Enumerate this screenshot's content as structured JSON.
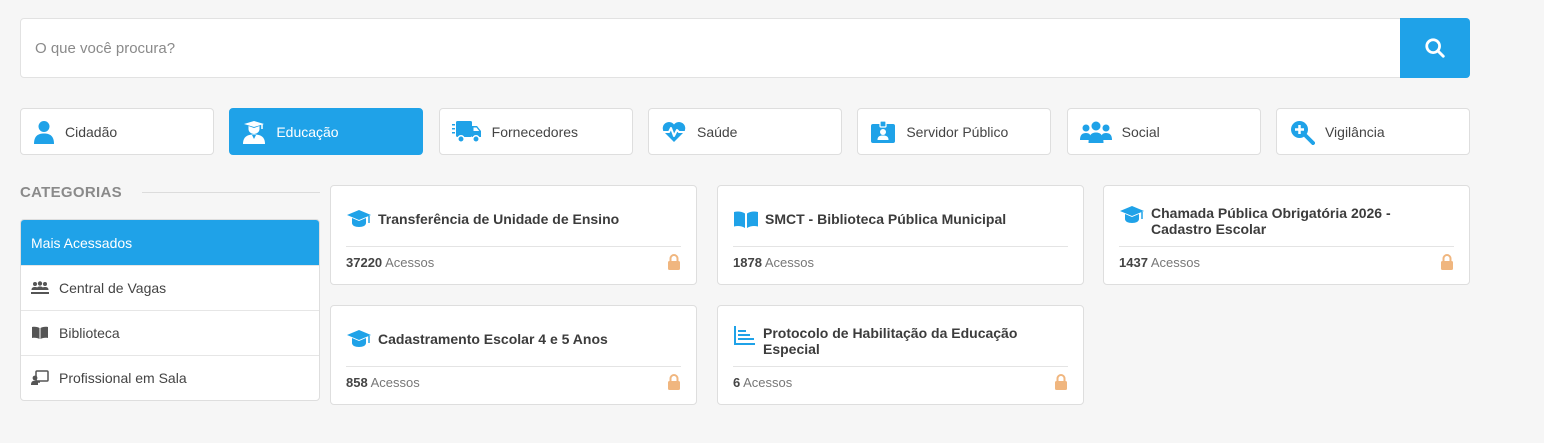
{
  "search": {
    "placeholder": "O que você procura?"
  },
  "colors": {
    "accent": "#1fa2e8",
    "lock": "#f0b67f"
  },
  "tabs": [
    {
      "label": "Cidadão",
      "icon": "user-icon",
      "active": false
    },
    {
      "label": "Educação",
      "icon": "teacher-icon",
      "active": true
    },
    {
      "label": "Fornecedores",
      "icon": "truck-icon",
      "active": false
    },
    {
      "label": "Saúde",
      "icon": "heartbeat-icon",
      "active": false
    },
    {
      "label": "Servidor Público",
      "icon": "id-badge-icon",
      "active": false
    },
    {
      "label": "Social",
      "icon": "users-icon",
      "active": false
    },
    {
      "label": "Vigilância",
      "icon": "search-plus-icon",
      "active": false
    }
  ],
  "categories": {
    "title": "CATEGORIAS",
    "items": [
      {
        "label": "Mais Acessados",
        "active": true,
        "icon": ""
      },
      {
        "label": "Central de Vagas",
        "active": false,
        "icon": "people-icon"
      },
      {
        "label": "Biblioteca",
        "active": false,
        "icon": "book-icon"
      },
      {
        "label": "Profissional em Sala",
        "active": false,
        "icon": "chalkboard-teacher-icon"
      }
    ]
  },
  "cards": [
    {
      "title": "Transferência de Unidade de Ensino",
      "count": "37220",
      "suffix": "Acessos",
      "icon": "graduation-cap-icon"
    },
    {
      "title": "SMCT - Biblioteca Pública Municipal",
      "count": "1878",
      "suffix": "Acessos",
      "icon": "book-open-icon"
    },
    {
      "title": "Chamada Pública Obrigatória 2026 - Cadastro Escolar",
      "count": "1437",
      "suffix": "Acessos",
      "icon": "graduation-cap-icon"
    },
    {
      "title": "Cadastramento Escolar 4 e 5 Anos",
      "count": "858",
      "suffix": "Acessos",
      "icon": "graduation-cap-icon"
    },
    {
      "title": "Protocolo de Habilitação da Educação Especial",
      "count": "6",
      "suffix": "Acessos",
      "icon": "chart-bar-icon"
    }
  ]
}
